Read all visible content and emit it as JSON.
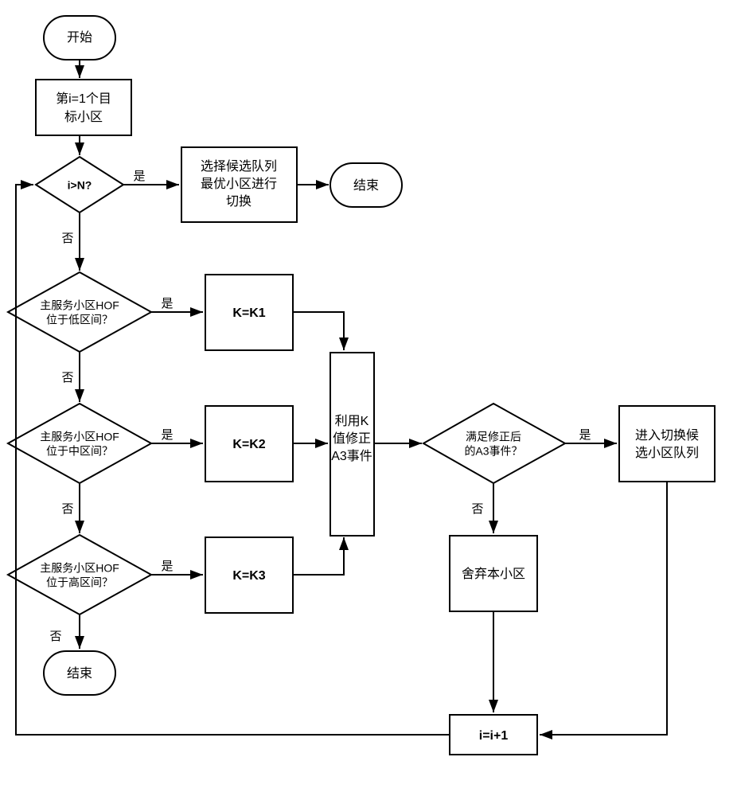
{
  "flowchart": {
    "start": "开始",
    "init_top": "第i=1个目",
    "init_bottom": "标小区",
    "loop_cond": "i>N?",
    "select_l1": "选择候选队列",
    "select_l2": "最优小区进行",
    "select_l3": "切换",
    "end1": "结束",
    "d1_l1": "主服务小区HOF",
    "d1_l2": "位于低区间？",
    "k1": "K=K1",
    "d2_l1": "主服务小区HOF",
    "d2_l2": "位于中区间？",
    "k2": "K=K2",
    "d3_l1": "主服务小区HOF",
    "d3_l2": "位于高区间？",
    "k3": "K=K3",
    "end2": "结束",
    "correct_l1": "利用K",
    "correct_l2": "值修正",
    "correct_l3": "A3事件",
    "satisfy_l1": "满足修正后",
    "satisfy_l2": "的A3事件？",
    "enter_l1": "进入切换候",
    "enter_l2": "选小区队列",
    "discard": "舍弃本小区",
    "increment": "i=i+1",
    "yes": "是",
    "no": "否"
  }
}
